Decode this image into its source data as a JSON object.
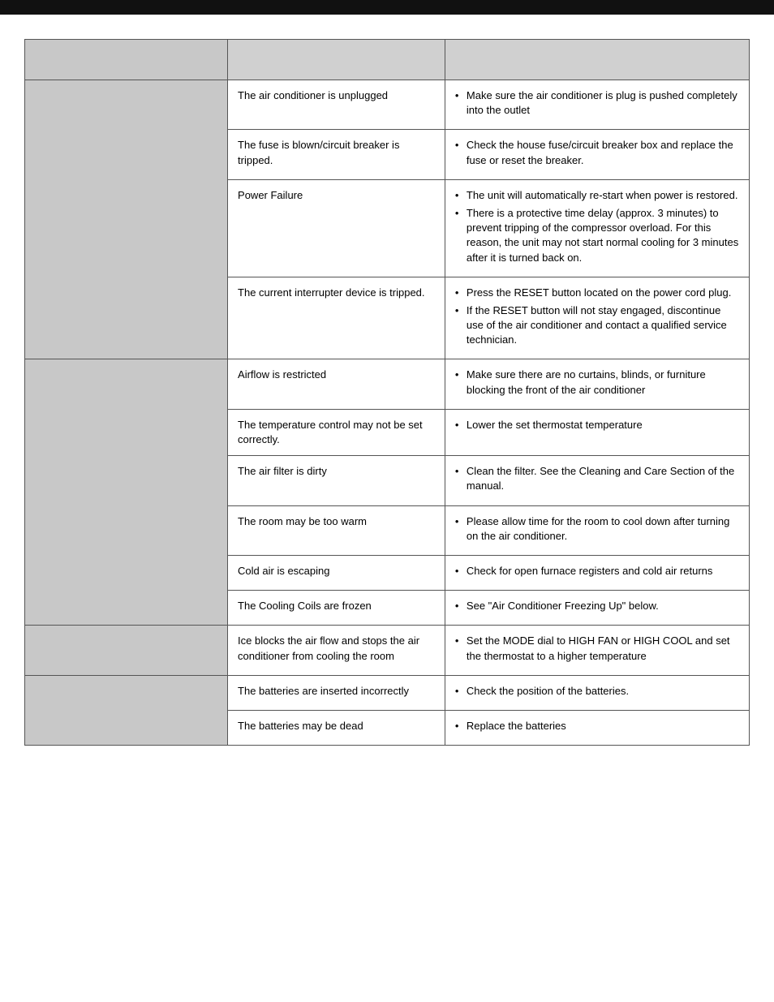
{
  "topbar": {},
  "table": {
    "headers": [
      "",
      "",
      ""
    ],
    "groups": [
      {
        "label": "",
        "rows": [
          {
            "cause": "The air conditioner is unplugged",
            "solutions": [
              "Make sure the air conditioner is plug is pushed completely into the outlet"
            ]
          },
          {
            "cause": "The fuse is blown/circuit breaker is tripped.",
            "solutions": [
              "Check the house fuse/circuit breaker box and replace the fuse or reset the breaker."
            ]
          },
          {
            "cause": "Power Failure",
            "solutions": [
              "The unit will automatically re-start when power is restored.",
              "There is a protective time delay (approx. 3 minutes) to prevent tripping of the compressor overload. For this reason, the unit may not start normal cooling for 3 minutes after it is turned back on."
            ]
          },
          {
            "cause": "The current interrupter device is tripped.",
            "solutions": [
              "Press the RESET button located on the power cord plug.",
              "If the RESET button will not stay engaged, discontinue use of the air conditioner and contact a qualified service technician."
            ]
          }
        ]
      },
      {
        "label": "",
        "rows": [
          {
            "cause": "Airflow is restricted",
            "solutions": [
              "Make sure there are no curtains, blinds, or furniture blocking the front of the air conditioner"
            ]
          },
          {
            "cause": "The temperature control may not be set correctly.",
            "solutions": [
              "Lower the set thermostat temperature"
            ]
          },
          {
            "cause": "The air filter is dirty",
            "solutions": [
              "Clean the filter. See the Cleaning and Care Section of the manual."
            ]
          },
          {
            "cause": "The room may be too warm",
            "solutions": [
              "Please allow time for the room to cool down after turning on the air conditioner."
            ]
          },
          {
            "cause": "Cold air is escaping",
            "solutions": [
              "Check for open furnace registers and cold air returns"
            ]
          },
          {
            "cause": "The Cooling Coils are frozen",
            "solutions": [
              "See \"Air Conditioner Freezing Up\" below."
            ]
          }
        ]
      },
      {
        "label": "",
        "rows": [
          {
            "cause": "Ice blocks the air flow and stops the air conditioner from cooling the room",
            "solutions": [
              "Set the MODE dial to HIGH FAN or HIGH COOL and set the thermostat to a higher temperature"
            ]
          }
        ]
      },
      {
        "label": "",
        "rows": [
          {
            "cause": "The batteries are inserted incorrectly",
            "solutions": [
              "Check the position of the batteries."
            ]
          },
          {
            "cause": "The batteries may be dead",
            "solutions": [
              "Replace the batteries"
            ]
          }
        ]
      }
    ]
  }
}
